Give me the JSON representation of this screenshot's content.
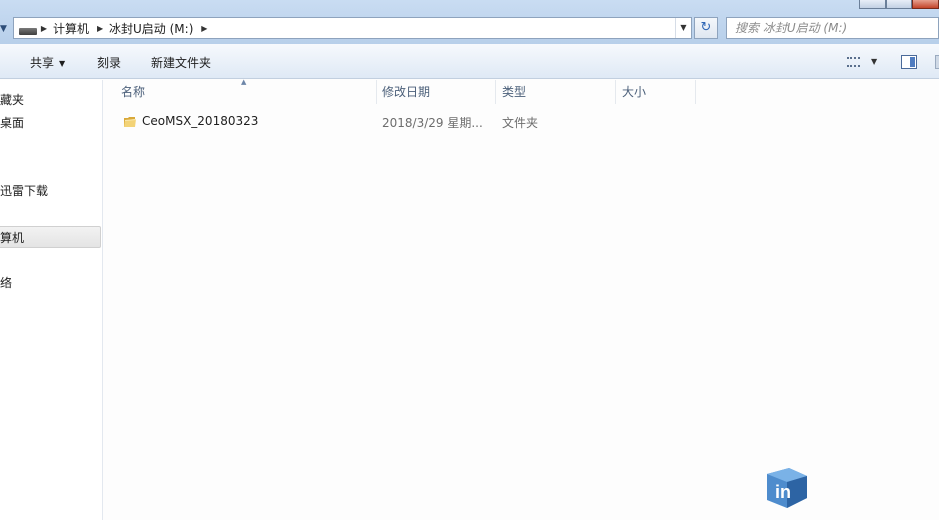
{
  "address_bar": {
    "crumbs": [
      "计算机",
      "冰封U启动 (M:)"
    ],
    "search_placeholder": "搜索 冰封U启动 (M:)"
  },
  "command_bar": {
    "share_label": "共享",
    "burn_label": "刻录",
    "new_folder_label": "新建文件夹"
  },
  "nav_pane": {
    "items": [
      {
        "label": "藏夹"
      },
      {
        "label": "桌面"
      },
      {
        "label": "迅雷下载"
      },
      {
        "label": "算机",
        "selected": true
      },
      {
        "label": "络"
      }
    ]
  },
  "file_list": {
    "columns": [
      "名称",
      "修改日期",
      "类型",
      "大小"
    ],
    "rows": [
      {
        "name": "CeoMSX_20180323",
        "modified": "2018/3/29 星期...",
        "type": "文件夹",
        "size": ""
      }
    ]
  },
  "icons": [
    "back-arrow-icon",
    "drive-icon",
    "chevron-right-icon",
    "dropdown-icon",
    "refresh-icon",
    "search-icon",
    "view-options-icon",
    "preview-pane-icon",
    "folder-icon",
    "watermark-logo-icon"
  ],
  "colors": {
    "chrome_top": "#c9dcf2",
    "command_bar": "#eaf1f9",
    "header_text": "#4c607a",
    "folder_yellow": "#e9c45a"
  },
  "watermark": {
    "logo_text": "in"
  }
}
